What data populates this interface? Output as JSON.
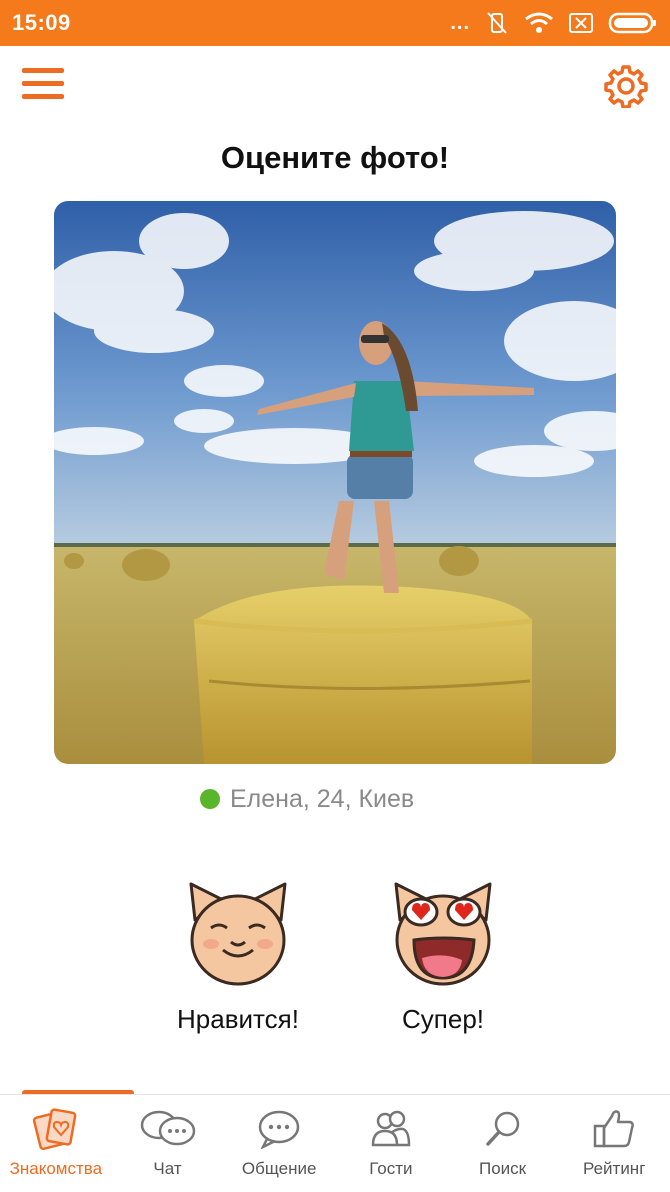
{
  "status_bar": {
    "time": "15:09",
    "dots": "..."
  },
  "header": {
    "title": "Оцените фото!"
  },
  "profile": {
    "info": "Елена, 24, Киев",
    "online_color": "#59b52a"
  },
  "actions": {
    "like_label": "Нравится!",
    "super_label": "Супер!"
  },
  "nav": {
    "active": "Знакомства",
    "items": [
      {
        "label": "Знакомства",
        "icon": "cards-heart-icon"
      },
      {
        "label": "Чат",
        "icon": "chat-bubbles-icon"
      },
      {
        "label": "Общение",
        "icon": "speech-bubble-icon"
      },
      {
        "label": "Гости",
        "icon": "guests-icon"
      },
      {
        "label": "Поиск",
        "icon": "search-icon"
      },
      {
        "label": "Рейтинг",
        "icon": "thumbs-up-icon"
      }
    ]
  },
  "colors": {
    "accent": "#ee6b22",
    "status_bar": "#f47a1c",
    "online": "#59b52a"
  }
}
